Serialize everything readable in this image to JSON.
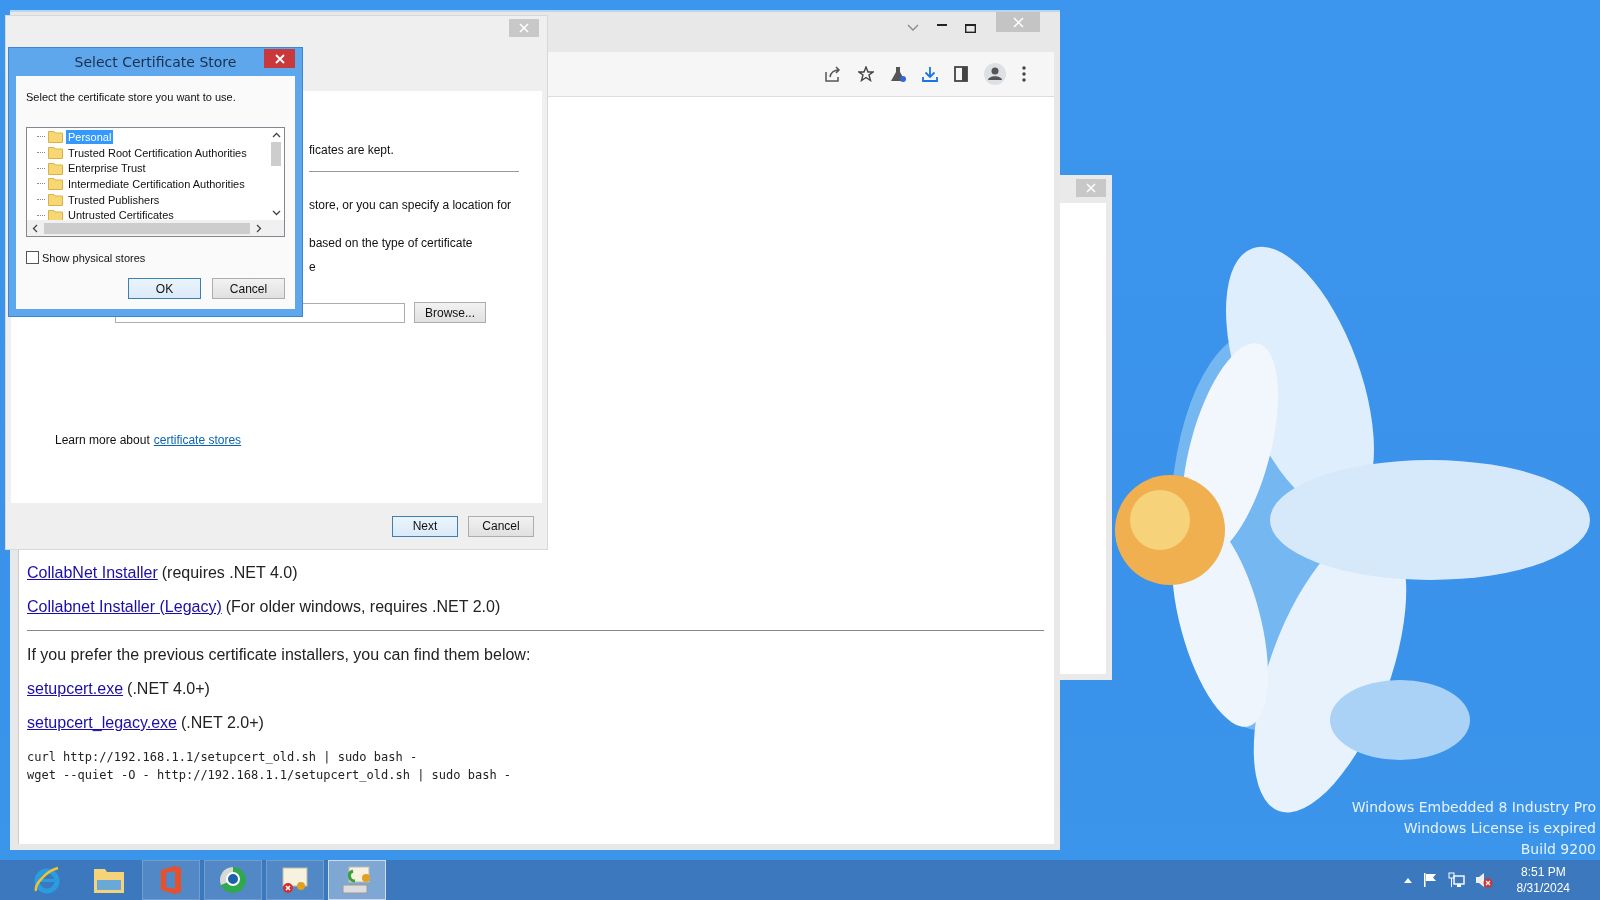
{
  "desktop": {
    "notice": [
      "Windows Embedded 8 Industry Pro",
      "Windows License is expired",
      "Build 9200"
    ]
  },
  "browser": {
    "content": [
      {
        "kind": "link_line",
        "link": "CollabNet Installer",
        "note": "(requires .NET 4.0)"
      },
      {
        "kind": "link_line",
        "link": "Collabnet Installer (Legacy)",
        "note": "(For older windows, requires .NET 2.0)"
      },
      {
        "kind": "rule"
      },
      {
        "kind": "text",
        "text": "If you prefer the previous certificate installers, you can find them below:"
      },
      {
        "kind": "link_line",
        "link": "setupcert.exe",
        "note": "(.NET 4.0+)"
      },
      {
        "kind": "link_line",
        "link": "setupcert_legacy.exe",
        "note": "(.NET 2.0+)"
      },
      {
        "kind": "code",
        "lines": [
          "curl http://192.168.1.1/setupcert_old.sh | sudo bash -",
          "wget --quiet -O - http://192.168.1.1/setupcert_old.sh | sudo bash -"
        ]
      }
    ]
  },
  "wizard": {
    "partial_texts": [
      "ficates are kept.",
      "store, or you can specify a location for",
      "based on the type of certificate",
      "e"
    ],
    "browse_button": "Browse...",
    "learn_more": {
      "text": "Learn more about",
      "link": "certificate stores"
    },
    "buttons": [
      {
        "label": "Next",
        "default": true
      },
      {
        "label": "Cancel",
        "default": false
      }
    ]
  },
  "store_dialog": {
    "title": "Select Certificate Store",
    "prompt": "Select the certificate store you want to use.",
    "stores": [
      {
        "label": "Personal",
        "selected": true
      },
      {
        "label": "Trusted Root Certification Authorities",
        "selected": false
      },
      {
        "label": "Enterprise Trust",
        "selected": false
      },
      {
        "label": "Intermediate Certification Authorities",
        "selected": false
      },
      {
        "label": "Trusted Publishers",
        "selected": false
      },
      {
        "label": "Untrusted Certificates",
        "selected": false
      }
    ],
    "show_physical": {
      "label": "Show physical stores",
      "checked": false
    },
    "buttons": [
      {
        "label": "OK",
        "default": true
      },
      {
        "label": "Cancel",
        "default": false
      }
    ]
  },
  "taskbar": {
    "apps": [
      {
        "kind": "browser",
        "active": false
      },
      {
        "kind": "folder",
        "active": false
      },
      {
        "kind": "office",
        "active": false
      },
      {
        "kind": "globe",
        "active": false
      },
      {
        "kind": "cert-error",
        "active": false
      },
      {
        "kind": "cert-install",
        "active": true
      }
    ],
    "time": "8:51 PM",
    "date": "8/31/2024"
  }
}
